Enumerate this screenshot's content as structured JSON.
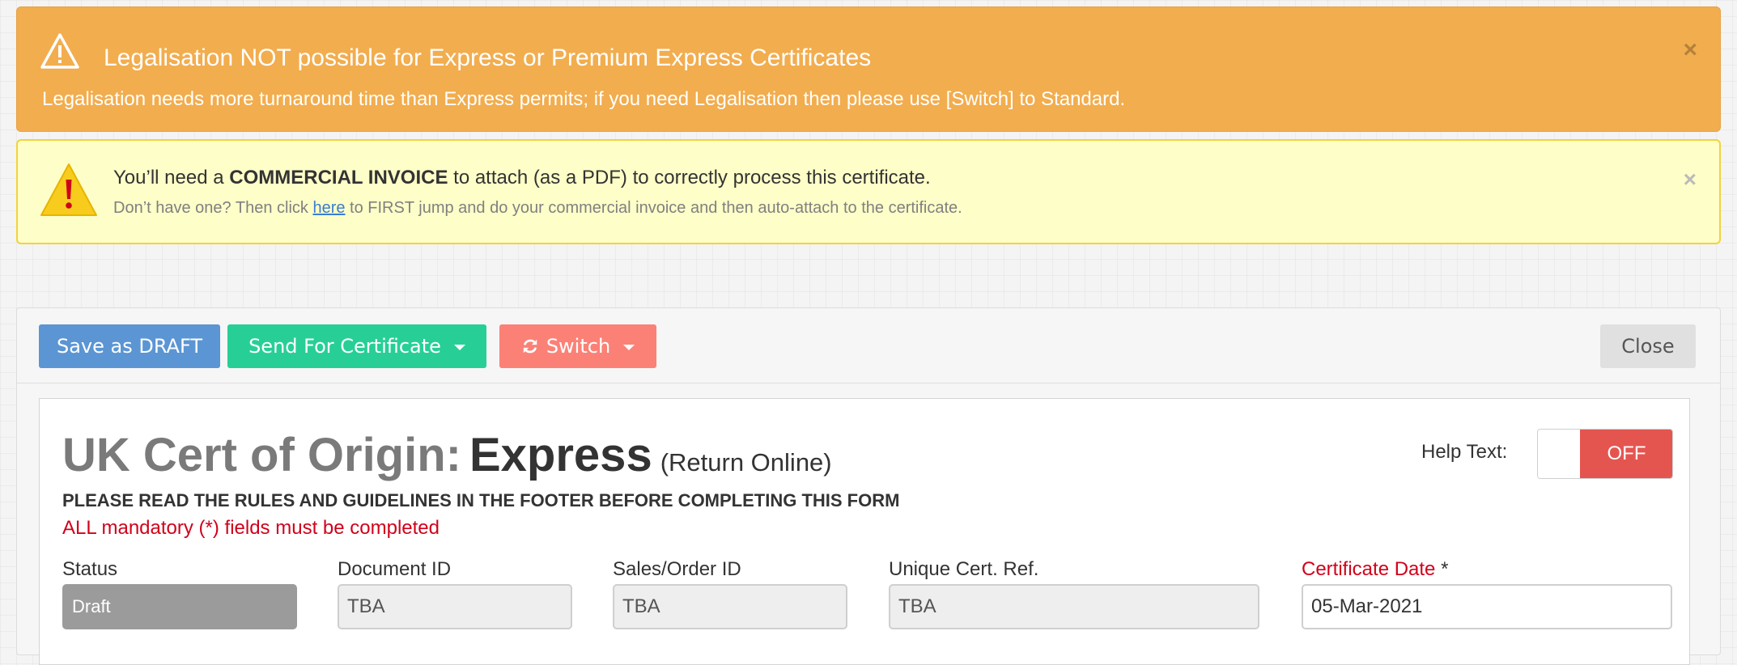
{
  "alerts": {
    "legalisation": {
      "icon": "warning-triangle-icon",
      "title": "Legalisation NOT possible for Express or Premium Express Certificates",
      "body": "Legalisation needs more turnaround time than Express permits; if you need Legalisation then please use [Switch] to Standard.",
      "close": "×",
      "color": "#f2ad4e"
    },
    "invoice": {
      "icon": "exclamation-triangle-icon",
      "line1_pre": "You’ll need a ",
      "line1_bold": "COMMERCIAL INVOICE",
      "line1_post": " to attach (as a PDF) to correctly process this certificate.",
      "line2_pre": "Don’t have one? Then click ",
      "line2_link": "here",
      "line2_post": " to FIRST jump and do your commercial invoice and then auto-attach to the certificate.",
      "close": "×",
      "color": "#fefec8"
    }
  },
  "toolbar": {
    "save_draft": "Save as DRAFT",
    "send": "Send For Certificate",
    "switch": "Switch",
    "close": "Close"
  },
  "form": {
    "title_prefix": "UK Cert of Origin:",
    "title_main": "Express",
    "title_suffix": "(Return Online)",
    "rules_notice": "PLEASE READ THE RULES AND GUIDELINES IN THE FOOTER BEFORE COMPLETING THIS FORM",
    "mandatory_notice": "ALL mandatory (*) fields must be completed",
    "help_text_label": "Help Text:",
    "help_toggle_state": "OFF",
    "fields": {
      "status": {
        "label": "Status",
        "value": "Draft"
      },
      "document_id": {
        "label": "Document ID",
        "value": "TBA"
      },
      "sales_order_id": {
        "label": "Sales/Order ID",
        "value": "TBA"
      },
      "unique_cert_ref": {
        "label": "Unique Cert. Ref.",
        "value": "TBA"
      },
      "certificate_date": {
        "label": "Certificate Date",
        "required_mark": "*",
        "value": "05-Mar-2021"
      }
    }
  },
  "colors": {
    "save_draft": "#5b95d3",
    "send": "#27cf97",
    "switch": "#fb8177",
    "required": "#d0021b",
    "toggle_off": "#e55550"
  }
}
